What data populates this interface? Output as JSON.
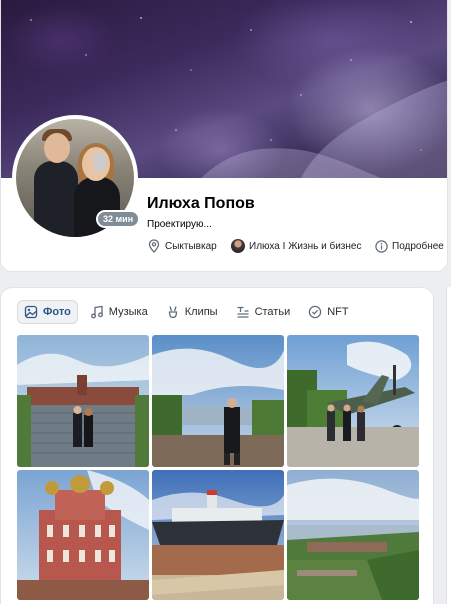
{
  "profile": {
    "name": "Илюха Попов",
    "status": "Проектирую...",
    "online_badge": "32 мин",
    "city": "Сыктывкар",
    "group": "Илюха I Жизнь и бизнес",
    "more": "Подробнее"
  },
  "media": {
    "tabs": [
      {
        "label": "Фото",
        "icon": "photo-icon",
        "active": true
      },
      {
        "label": "Музыка",
        "icon": "music-icon",
        "active": false
      },
      {
        "label": "Клипы",
        "icon": "clips-icon",
        "active": false
      },
      {
        "label": "Статьи",
        "icon": "articles-icon",
        "active": false
      },
      {
        "label": "NFT",
        "icon": "nft-icon",
        "active": false
      }
    ]
  },
  "colors": {
    "accent": "#2a5885",
    "badge": "#818c99",
    "page_bg": "#edeef0"
  }
}
